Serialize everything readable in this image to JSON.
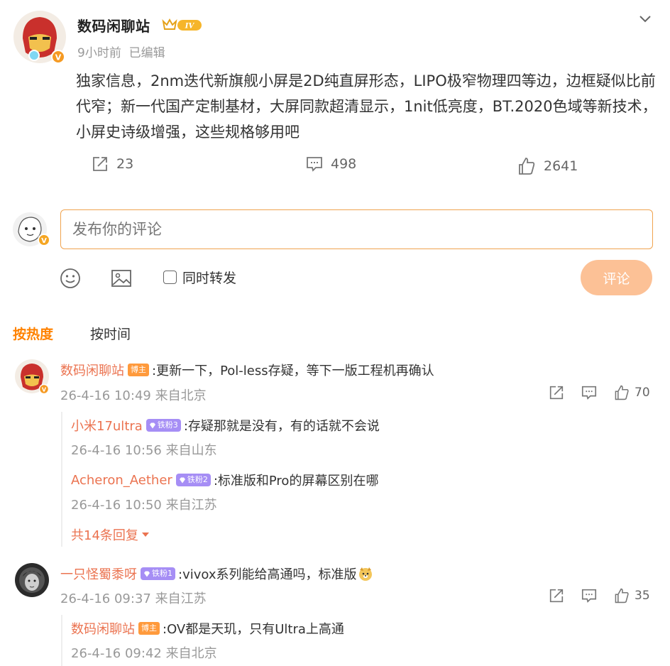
{
  "post": {
    "author": "数码闲聊站",
    "level_badge": "IV",
    "time": "9小时前",
    "edited": "已编辑",
    "text": "独家信息，2nm迭代新旗舰小屏是2D纯直屏形态，LIPO极窄物理四等边，边框疑似比前代窄；新一代国产定制基材，大屏同款超清显示，1nit低亮度，BT.2020色域等新技术，小屏史诗级增强，这些规格够用吧",
    "shares": "23",
    "comments": "498",
    "likes": "2641"
  },
  "compose": {
    "placeholder": "发布你的评论",
    "repost_label": "同时转发",
    "submit_label": "评论"
  },
  "sort": {
    "hot": "按热度",
    "time": "按时间"
  },
  "comments": [
    {
      "user": "数码闲聊站",
      "badge": "博主",
      "text": ":更新一下，Pol-less存疑，等下一版工程机再确认",
      "meta": "26-4-16 10:49 来自北京",
      "likes": "70",
      "replies": [
        {
          "user": "小米17ultra",
          "badge": "铁粉3",
          "text": ":存疑那就是没有，有的话就不会说",
          "meta": "26-4-16 10:56 来自山东"
        },
        {
          "user": "Acheron_Aether",
          "badge": "铁粉2",
          "text": ":标准版和Pro的屏幕区别在哪",
          "meta": "26-4-16 10:50 来自江苏"
        }
      ],
      "more_replies": "共14条回复"
    },
    {
      "user": "一只怪蜀黍呀",
      "badge": "铁粉1",
      "text": ":vivox系列能给高通吗，标准版",
      "meta": "26-4-16 09:37 来自江苏",
      "likes": "35",
      "replies": [
        {
          "user": "数码闲聊站",
          "badge": "博主",
          "text": ":OV都是天玑，只有Ultra上高通",
          "meta": "26-4-16 09:42 来自北京"
        }
      ]
    }
  ],
  "colors": {
    "accent": "#ff8200",
    "username": "#eb7350",
    "input_border": "#f0a34f",
    "button": "#fcc196",
    "fan_badge": "#a68ef5",
    "host_badge": "#ff9a3c"
  },
  "icons": [
    "iron-man-avatar",
    "crown-icon",
    "chevron-down-icon",
    "share-icon",
    "comment-icon",
    "like-icon",
    "smile-icon",
    "image-icon",
    "checkbox",
    "diamond-icon",
    "emoji-dog-icon"
  ]
}
